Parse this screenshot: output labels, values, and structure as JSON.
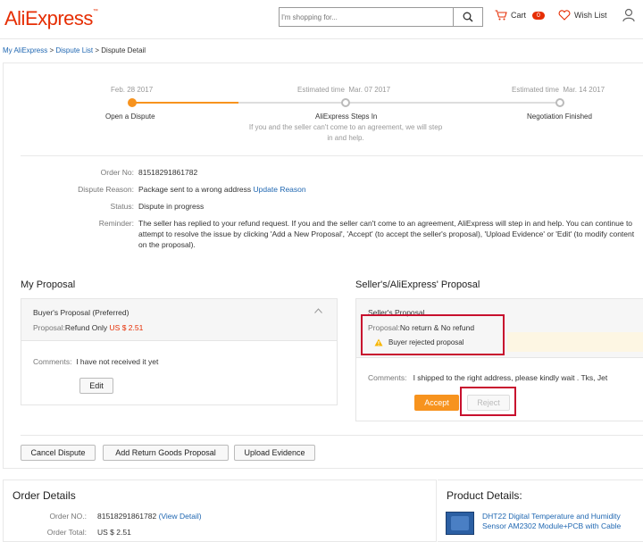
{
  "header": {
    "logo": "AliExpress",
    "logo_tm": "™",
    "search_placeholder": "I'm shopping for...",
    "cart_label": "Cart",
    "cart_count": "0",
    "wish_label": "Wish List"
  },
  "breadcrumb": {
    "my_aliexpress": "My AliExpress",
    "sep1": " > ",
    "dispute_list": "Dispute List",
    "sep2": " > ",
    "current": "Dispute Detail"
  },
  "timeline": {
    "step1": {
      "date": "Feb. 28 2017",
      "label": "Open a Dispute"
    },
    "step2": {
      "est": "Estimated time",
      "date": "Mar. 07 2017",
      "label": "AliExpress Steps In",
      "desc1": "If you and the seller can't come to an agreement, we will step",
      "desc2": "in and help."
    },
    "step3": {
      "est": "Estimated time",
      "date": "Mar. 14 2017",
      "label": "Negotiation Finished"
    }
  },
  "info": {
    "order_no_label": "Order No:",
    "order_no": "81518291861782",
    "reason_label": "Dispute Reason:",
    "reason": "Package sent to a wrong address",
    "update_reason": "Update Reason",
    "status_label": "Status:",
    "status": "Dispute in progress",
    "reminder_label": "Reminder:",
    "reminder_line1": "The seller has replied to your refund request. If you and the seller can't come to an agreement, AliExpress will step in and help. You can continue to",
    "reminder_line2": "attempt to resolve the issue by clicking 'Add a New Proposal', 'Accept' (to accept the seller's proposal), 'Upload Evidence' or 'Edit' (to modify content",
    "reminder_line3": "on the proposal)."
  },
  "my_proposal": {
    "title": "My Proposal",
    "heading": "Buyer's Proposal (Preferred)",
    "proposal_label": "Proposal:",
    "proposal_value": "Refund Only",
    "amount": "US $ 2.51",
    "comments_label": "Comments:",
    "comments": "I have not received it yet",
    "edit": "Edit"
  },
  "seller_proposal": {
    "title": "Seller's/AliExpress' Proposal",
    "heading": "Seller's Proposal",
    "proposal_label": "Proposal:",
    "proposal_value": "No return & No refund",
    "warning": "Buyer rejected proposal",
    "comments_label": "Comments:",
    "comments": "I shipped to the right address, please kindly wait . Tks, Jet",
    "accept": "Accept",
    "reject": "Reject"
  },
  "actions": {
    "cancel": "Cancel Dispute",
    "add_return": "Add Return Goods Proposal",
    "upload": "Upload Evidence"
  },
  "order_details": {
    "title": "Order Details",
    "order_no_label": "Order NO.:",
    "order_no": "81518291861782",
    "view_detail": "(View Detail)",
    "total_label": "Order Total:",
    "total": "US $ 2.51"
  },
  "product_details": {
    "title": "Product Details:",
    "name_line1": "DHT22 Digital Temperature and Humidity",
    "name_line2": "Sensor AM2302 Module+PCB with Cable"
  },
  "colors": {
    "brand": "#e62e04",
    "accent": "#f7931e",
    "link": "#2168b2",
    "status": "#0a9b3a",
    "highlight": "#c8102e"
  }
}
